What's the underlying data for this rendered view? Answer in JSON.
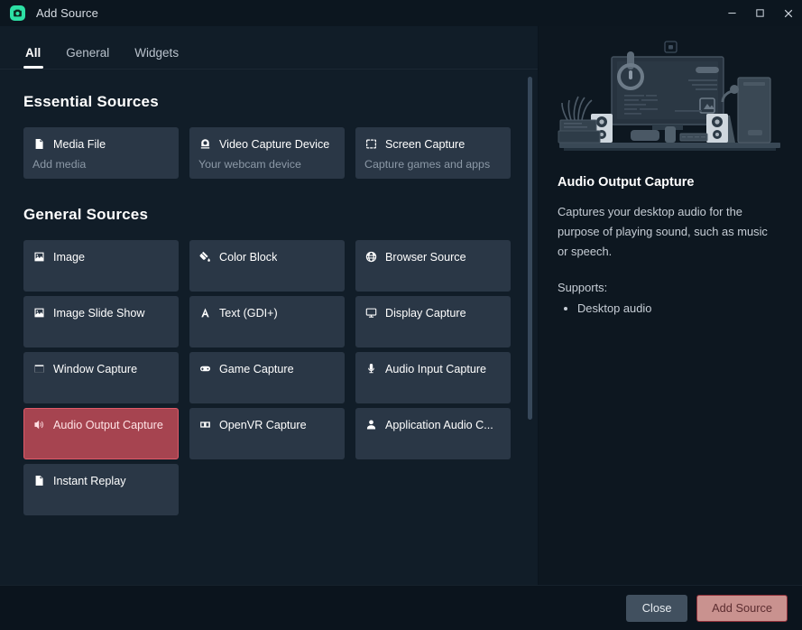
{
  "window": {
    "title": "Add Source",
    "app_icon": "camera-app-icon",
    "controls": [
      {
        "name": "minimize",
        "glyph": "minimize-icon"
      },
      {
        "name": "maximize",
        "glyph": "maximize-icon"
      },
      {
        "name": "close",
        "glyph": "close-icon"
      }
    ]
  },
  "tabs": [
    {
      "label": "All",
      "active": true
    },
    {
      "label": "General",
      "active": false
    },
    {
      "label": "Widgets",
      "active": false
    }
  ],
  "sections": [
    {
      "id": "essential",
      "title": "Essential Sources",
      "cards": [
        {
          "label": "Media File",
          "sub": "Add media",
          "icon": "media-file-icon",
          "selected": false
        },
        {
          "label": "Video Capture Device",
          "sub": "Your webcam device",
          "icon": "webcam-icon",
          "selected": false
        },
        {
          "label": "Screen Capture",
          "sub": "Capture games and apps",
          "icon": "screen-capture-icon",
          "selected": false
        }
      ]
    },
    {
      "id": "general",
      "title": "General Sources",
      "cards": [
        {
          "label": "Image",
          "sub": "",
          "icon": "image-icon",
          "selected": false
        },
        {
          "label": "Color Block",
          "sub": "",
          "icon": "color-block-icon",
          "selected": false
        },
        {
          "label": "Browser Source",
          "sub": "",
          "icon": "globe-icon",
          "selected": false
        },
        {
          "label": "Image Slide Show",
          "sub": "",
          "icon": "image-icon",
          "selected": false
        },
        {
          "label": "Text (GDI+)",
          "sub": "",
          "icon": "text-a-icon",
          "selected": false
        },
        {
          "label": "Display Capture",
          "sub": "",
          "icon": "monitor-icon",
          "selected": false
        },
        {
          "label": "Window Capture",
          "sub": "",
          "icon": "window-icon",
          "selected": false
        },
        {
          "label": "Game Capture",
          "sub": "",
          "icon": "gamepad-icon",
          "selected": false
        },
        {
          "label": "Audio Input Capture",
          "sub": "",
          "icon": "microphone-icon",
          "selected": false
        },
        {
          "label": "Audio Output Capture",
          "sub": "",
          "icon": "speaker-icon",
          "selected": true
        },
        {
          "label": "OpenVR Capture",
          "sub": "",
          "icon": "vr-headset-icon",
          "selected": false
        },
        {
          "label": "Application Audio C...",
          "sub": "",
          "icon": "person-icon",
          "selected": false
        },
        {
          "label": "Instant Replay",
          "sub": "",
          "icon": "document-icon",
          "selected": false
        }
      ]
    }
  ],
  "detail": {
    "illustration": "desk-workstation-illustration",
    "title": "Audio Output Capture",
    "description": "Captures your desktop audio for the purpose of playing sound, such as music or speech.",
    "supports_label": "Supports:",
    "supports_items": [
      "Desktop audio"
    ]
  },
  "footer": {
    "close_label": "Close",
    "add_label": "Add Source"
  },
  "colors": {
    "window_bg": "#111d28",
    "titlebar_bg": "#0c161f",
    "card_bg": "#2a3746",
    "selected_bg": "#a64450",
    "selected_border": "#e05a68",
    "accent_icon": "#2de0a5",
    "detail_bg": "#0d1720",
    "footer_bg": "#0b141d",
    "close_btn": "#41505f",
    "add_btn": "#c9928f"
  }
}
